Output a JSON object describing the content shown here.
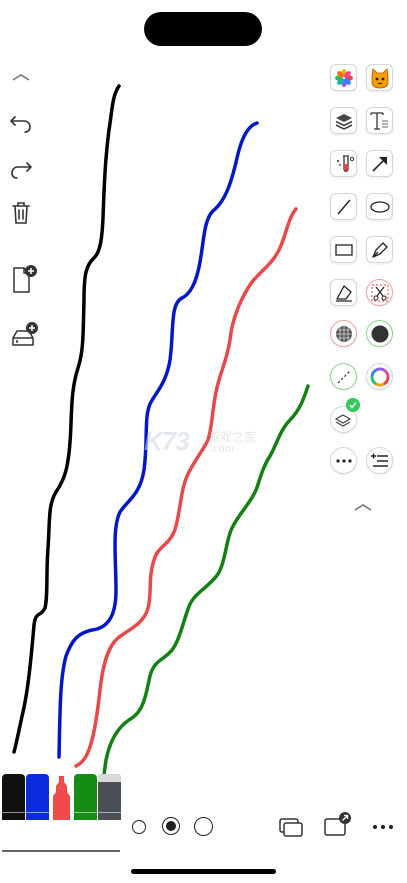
{
  "app": {
    "screen": "whiteboard-drawing"
  },
  "left_toolbar": {
    "items": [
      {
        "name": "collapse",
        "icon": "chevron-up-icon"
      },
      {
        "name": "undo",
        "icon": "undo-icon"
      },
      {
        "name": "redo",
        "icon": "redo-icon"
      },
      {
        "name": "delete",
        "icon": "trash-icon"
      },
      {
        "name": "new-page",
        "icon": "new-page-icon"
      },
      {
        "name": "save",
        "icon": "save-drive-icon"
      }
    ]
  },
  "right_toolbar": {
    "tools": [
      {
        "name": "photos",
        "icon": "photos-icon"
      },
      {
        "name": "sticker",
        "icon": "cat-sticker-icon"
      },
      {
        "name": "layers",
        "icon": "layers-icon"
      },
      {
        "name": "text",
        "icon": "text-icon"
      },
      {
        "name": "science",
        "icon": "test-tube-icon"
      },
      {
        "name": "arrow",
        "icon": "arrow-icon"
      },
      {
        "name": "line",
        "icon": "line-icon"
      },
      {
        "name": "ellipse",
        "icon": "ellipse-icon"
      },
      {
        "name": "rectangle",
        "icon": "rectangle-icon"
      },
      {
        "name": "pen",
        "icon": "pen-nib-icon"
      },
      {
        "name": "eraser",
        "icon": "eraser-icon"
      },
      {
        "name": "scissors",
        "icon": "scissors-icon"
      },
      {
        "name": "grid-color",
        "icon": "grid-color-icon"
      },
      {
        "name": "fill-color",
        "icon": "fill-circle-icon"
      },
      {
        "name": "line-style",
        "icon": "dashed-line-icon"
      },
      {
        "name": "color-wheel",
        "icon": "color-wheel-icon"
      },
      {
        "name": "layer-select",
        "icon": "layers-check-icon"
      },
      {
        "name": "more",
        "icon": "more-icon"
      },
      {
        "name": "list-add",
        "icon": "list-add-icon"
      },
      {
        "name": "collapse-right",
        "icon": "chevron-up-icon"
      }
    ]
  },
  "watermark": {
    "logo_text": "K73",
    "name": "游戏之家",
    "url": ".com"
  },
  "strokes": [
    {
      "color": "#000000",
      "name": "black-stroke"
    },
    {
      "color": "#0000cc",
      "name": "blue-stroke"
    },
    {
      "color": "#e54545",
      "name": "red-stroke"
    },
    {
      "color": "#108010",
      "name": "green-stroke"
    }
  ],
  "bottom_bar": {
    "pens": [
      {
        "name": "black",
        "color": "#111111"
      },
      {
        "name": "blue",
        "color": "#0a2be0"
      },
      {
        "name": "red",
        "color": "#f04a4a"
      },
      {
        "name": "green",
        "color": "#168c16"
      },
      {
        "name": "gray",
        "color": "#4a5056"
      }
    ],
    "selected_size": "medium",
    "icons": [
      "windows-icon",
      "share-window-icon",
      "more-horizontal-icon"
    ]
  }
}
